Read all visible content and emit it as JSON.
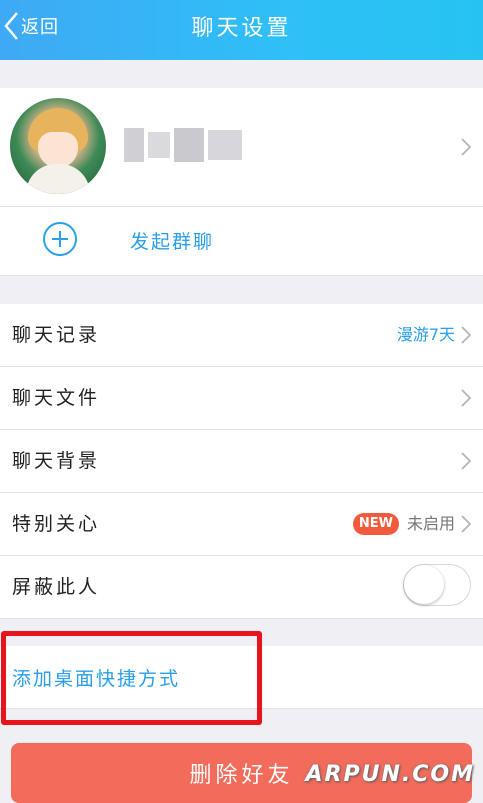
{
  "header": {
    "back_label": "返回",
    "title": "聊天设置",
    "background": "#2ec0f6"
  },
  "profile": {
    "avatar_icon": "anime-avatar",
    "name_hidden": true
  },
  "start_group": {
    "label": "发起群聊",
    "icon": "plus-circle-icon",
    "color": "#2a9ee8"
  },
  "settings": {
    "chat_history": {
      "label": "聊天记录",
      "value": "漫游7天"
    },
    "chat_files": {
      "label": "聊天文件"
    },
    "chat_background": {
      "label": "聊天背景"
    },
    "special_care": {
      "label": "特别关心",
      "badge": "NEW",
      "value": "未启用"
    },
    "block_person": {
      "label": "屏蔽此人",
      "toggle_on": false
    }
  },
  "shortcut": {
    "label": "添加桌面快捷方式",
    "highlight_color": "#e8131b"
  },
  "delete_friend": {
    "label": "删除好友",
    "color": "#f26b5b"
  },
  "watermark": "ARPUN.COM"
}
